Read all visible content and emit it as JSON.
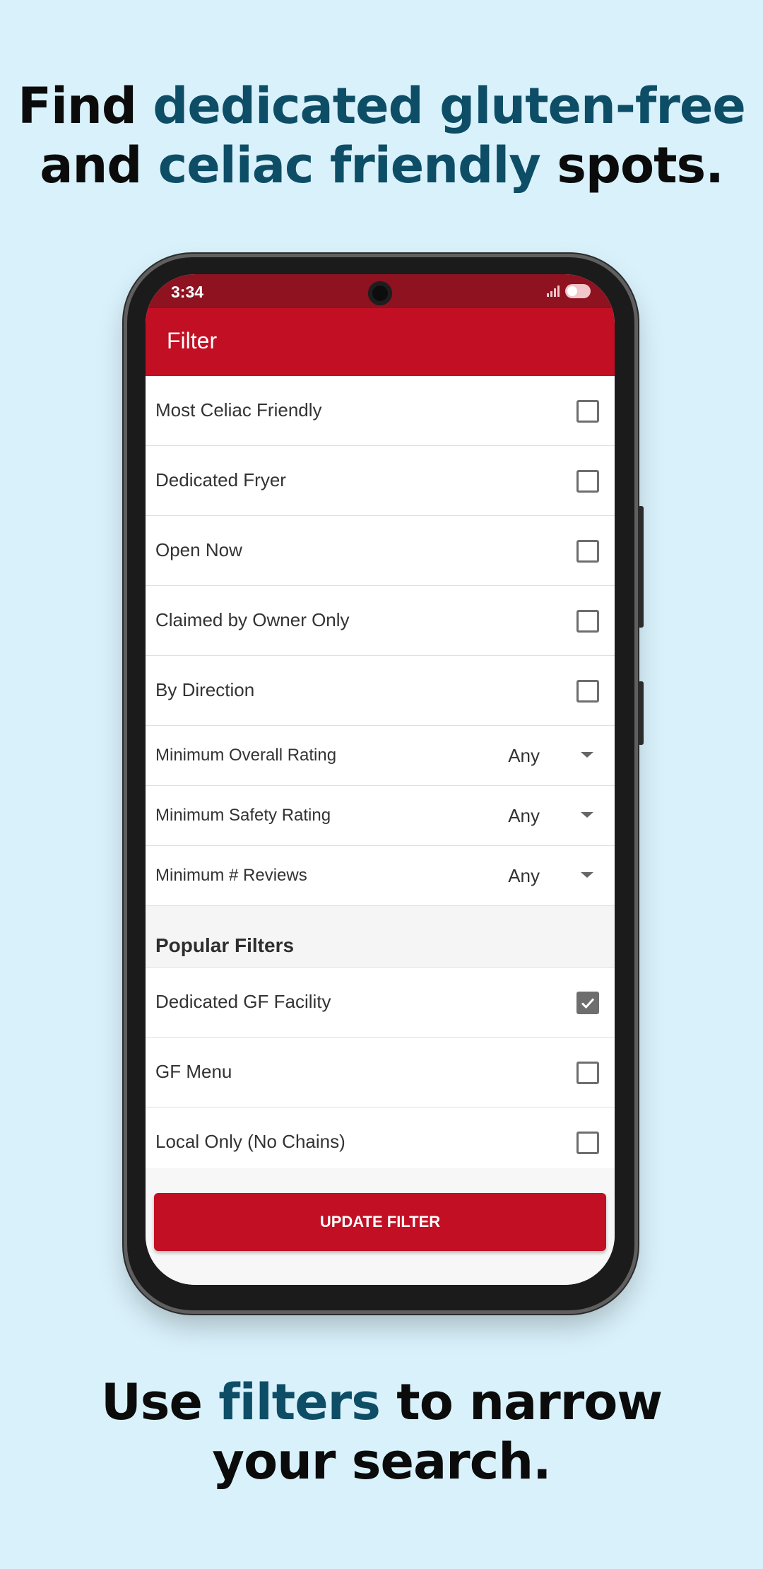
{
  "headline_top": {
    "part1": "Find ",
    "part2": "dedicated gluten-free",
    "part3": "and ",
    "part4": "celiac friendly",
    "part5": " spots."
  },
  "headline_bottom": {
    "part1": "Use ",
    "part2": "filters",
    "part3": " to narrow",
    "part4": "your search."
  },
  "status_bar": {
    "time": "3:34"
  },
  "app_bar": {
    "title": "Filter"
  },
  "filters": [
    {
      "label": "Most Celiac Friendly",
      "checked": false
    },
    {
      "label": "Dedicated Fryer",
      "checked": false
    },
    {
      "label": "Open Now",
      "checked": false
    },
    {
      "label": "Claimed by Owner Only",
      "checked": false
    },
    {
      "label": "By Direction",
      "checked": false
    }
  ],
  "dropdowns": [
    {
      "label": "Minimum Overall Rating",
      "value": "Any"
    },
    {
      "label": "Minimum Safety Rating",
      "value": "Any"
    },
    {
      "label": "Minimum # Reviews",
      "value": "Any"
    }
  ],
  "popular_section": {
    "title": "Popular Filters"
  },
  "popular_filters": [
    {
      "label": "Dedicated GF Facility",
      "checked": true
    },
    {
      "label": "GF Menu",
      "checked": false
    },
    {
      "label": "Local Only (No Chains)",
      "checked": false
    }
  ],
  "update_button": {
    "label": "UPDATE FILTER"
  },
  "colors": {
    "page_background": "#d9f1fb",
    "headline_accent": "#0d4e66",
    "brand_red": "#c20f24",
    "status_bar_red": "#8e1220"
  }
}
